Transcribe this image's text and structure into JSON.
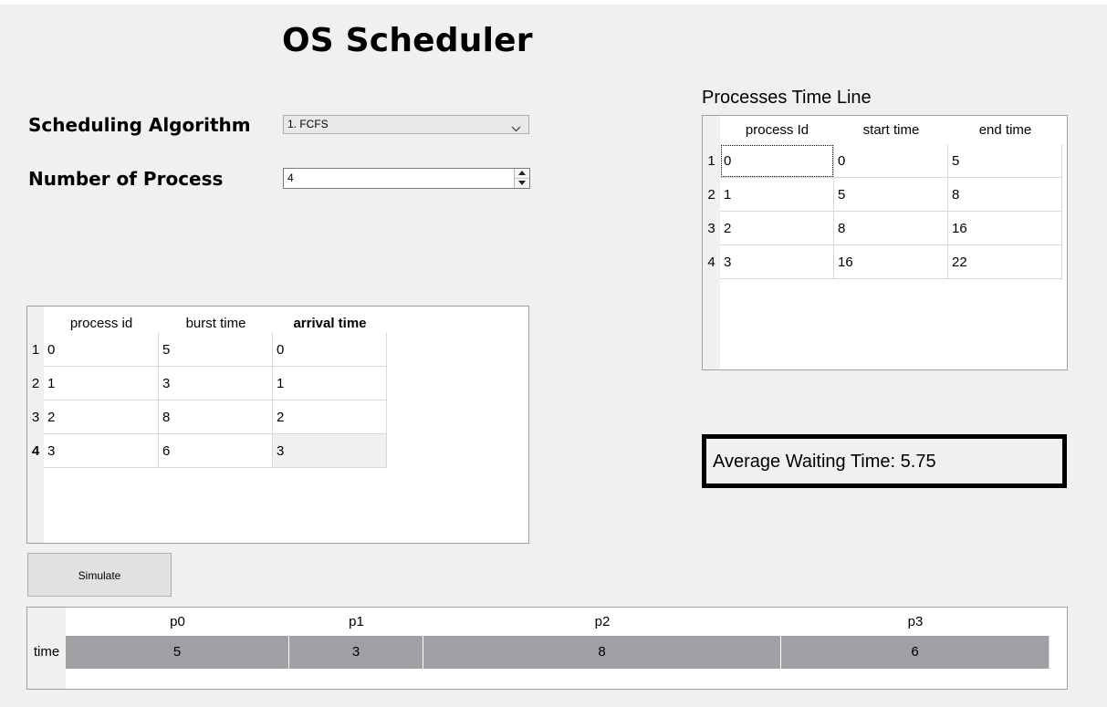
{
  "title": "OS Scheduler",
  "algorithm": {
    "label": "Scheduling Algorithm",
    "selected": "1. FCFS"
  },
  "process_count": {
    "label": "Number of Process",
    "value": "4"
  },
  "input_table": {
    "headers": [
      "process id",
      "burst time",
      "arrival time"
    ],
    "row_numbers": [
      "1",
      "2",
      "3",
      "4"
    ],
    "rows": [
      [
        "0",
        "5",
        "0"
      ],
      [
        "1",
        "3",
        "1"
      ],
      [
        "2",
        "8",
        "2"
      ],
      [
        "3",
        "6",
        "3"
      ]
    ]
  },
  "simulate_label": "Simulate",
  "timeline": {
    "title": "Processes  Time Line",
    "headers": [
      "process Id",
      "start time",
      "end time"
    ],
    "row_numbers": [
      "1",
      "2",
      "3",
      "4"
    ],
    "rows": [
      [
        "0",
        "0",
        "5"
      ],
      [
        "1",
        "5",
        "8"
      ],
      [
        "2",
        "8",
        "16"
      ],
      [
        "3",
        "16",
        "22"
      ]
    ]
  },
  "average_waiting": "Average Waiting Time: 5.75",
  "gantt": {
    "row_label": "time",
    "processes": [
      "p0",
      "p1",
      "p2",
      "p3"
    ],
    "times": [
      "5",
      "3",
      "8",
      "6"
    ],
    "bar_color": "#a0a0a4"
  }
}
